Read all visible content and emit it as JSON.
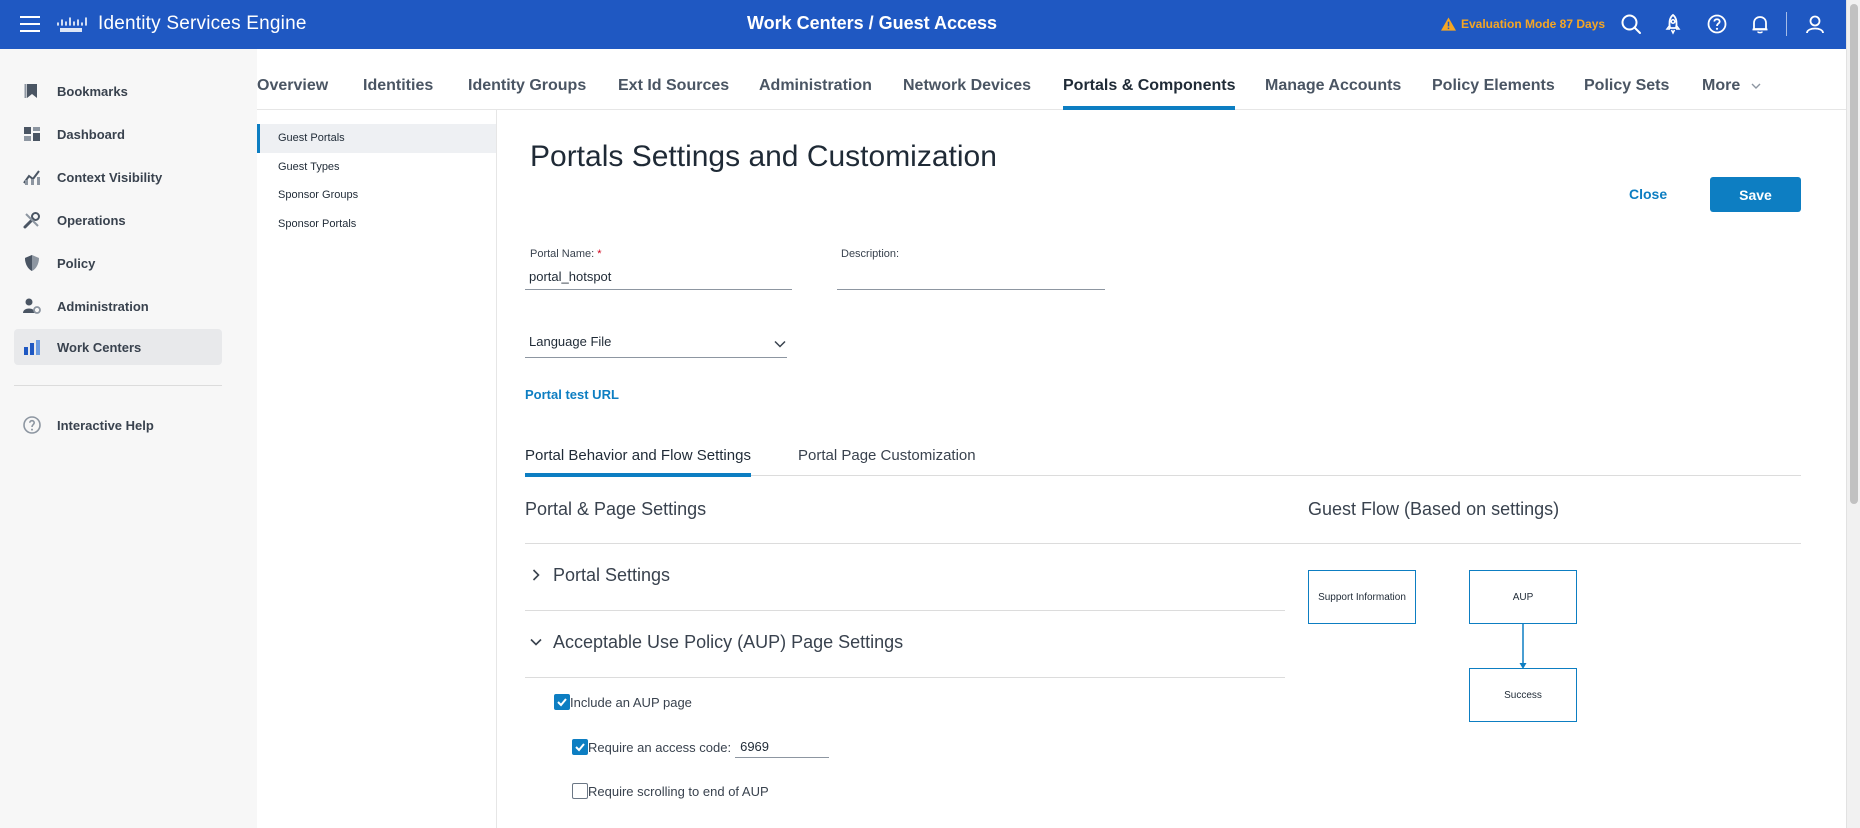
{
  "header": {
    "app_title": "Identity Services Engine",
    "page_title": "Work Centers / Guest Access",
    "evaluation": "Evaluation Mode 87 Days"
  },
  "sidebar": {
    "items": [
      {
        "label": "Bookmarks",
        "icon": "bookmark-icon"
      },
      {
        "label": "Dashboard",
        "icon": "dashboard-icon"
      },
      {
        "label": "Context Visibility",
        "icon": "context-visibility-icon"
      },
      {
        "label": "Operations",
        "icon": "operations-wrench-icon"
      },
      {
        "label": "Policy",
        "icon": "policy-shield-icon"
      },
      {
        "label": "Administration",
        "icon": "administration-icon"
      },
      {
        "label": "Work Centers",
        "icon": "work-centers-icon"
      }
    ],
    "help": "Interactive Help"
  },
  "tabs": [
    {
      "label": "Overview"
    },
    {
      "label": "Identities"
    },
    {
      "label": "Identity Groups"
    },
    {
      "label": "Ext Id Sources"
    },
    {
      "label": "Administration"
    },
    {
      "label": "Network Devices"
    },
    {
      "label": "Portals & Components"
    },
    {
      "label": "Manage Accounts"
    },
    {
      "label": "Policy Elements"
    },
    {
      "label": "Policy Sets"
    },
    {
      "label": "More"
    }
  ],
  "subnav": [
    {
      "label": "Guest Portals"
    },
    {
      "label": "Guest Types"
    },
    {
      "label": "Sponsor Groups"
    },
    {
      "label": "Sponsor Portals"
    }
  ],
  "main": {
    "title": "Portals Settings and Customization",
    "close_label": "Close",
    "save_label": "Save",
    "portal_name_label": "Portal Name:",
    "required_mark": "*",
    "portal_name_value": "portal_hotspot",
    "description_label": "Description:",
    "description_value": "",
    "language_file": "Language File",
    "portal_test_url": "Portal test URL",
    "form_tabs": [
      "Portal Behavior and Flow Settings",
      "Portal Page Customization"
    ],
    "settings_heading": "Portal & Page Settings",
    "flow_heading": "Guest Flow (Based on settings)",
    "portal_settings": "Portal Settings",
    "aup_settings": "Acceptable Use Policy (AUP) Page Settings",
    "include_aup": "Include an AUP page",
    "require_access_code": "Require an access code:",
    "access_code_value": "6969",
    "require_scrolling": "Require scrolling to end of AUP",
    "flow_boxes": [
      "Support Information",
      "AUP",
      "Success"
    ]
  },
  "colors": {
    "header": "#1f58c2",
    "accent": "#0d7ec2",
    "warning": "#f5a623"
  }
}
